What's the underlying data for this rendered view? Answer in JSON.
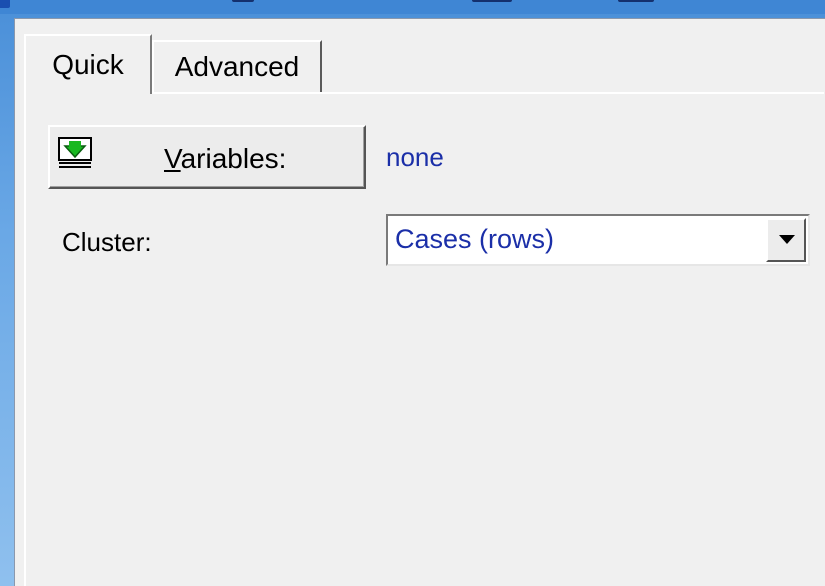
{
  "tabs": [
    {
      "label": "Quick",
      "active": true
    },
    {
      "label": "Advanced",
      "active": false
    }
  ],
  "variables": {
    "button_label_mnemonic": "V",
    "button_label_rest": "ariables:",
    "value": "none",
    "icon": "variables-select-icon"
  },
  "cluster": {
    "label": "Cluster:",
    "selected": "Cases (rows)"
  },
  "colors": {
    "value_text": "#1b2fa8",
    "title_bar": "#3f86d4",
    "panel": "#f0f0f0"
  }
}
